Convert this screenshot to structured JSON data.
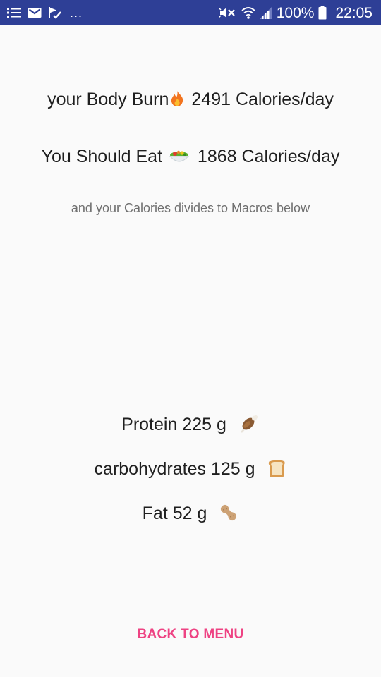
{
  "status_bar": {
    "battery_text": "100%",
    "time": "22:05",
    "overflow": "...",
    "icons": [
      "list-icon",
      "mail-icon",
      "check-flag-icon",
      "mute-icon",
      "wifi-icon",
      "signal-icon",
      "battery-icon"
    ]
  },
  "summary": {
    "burn_prefix": "your Body Burn",
    "burn_icon": "fire-icon",
    "burn_value": "2491 Calories/day",
    "eat_prefix": "You Should Eat",
    "eat_icon": "salad-icon",
    "eat_value": "1868 Calories/day",
    "macros_caption": "and your Calories divides to Macros below"
  },
  "macros": {
    "protein": {
      "label": "Protein 225 g",
      "icon": "meat-icon"
    },
    "carbs": {
      "label": "carbohydrates 125 g",
      "icon": "bread-icon"
    },
    "fat": {
      "label": "Fat 52 g",
      "icon": "peanut-icon"
    }
  },
  "actions": {
    "back_label": "BACK TO MENU"
  },
  "colors": {
    "status_bar": "#2e3f96",
    "accent": "#ee4383",
    "text": "#1f1f1f",
    "subtext": "#6f6f6f",
    "background": "#fafafa"
  }
}
